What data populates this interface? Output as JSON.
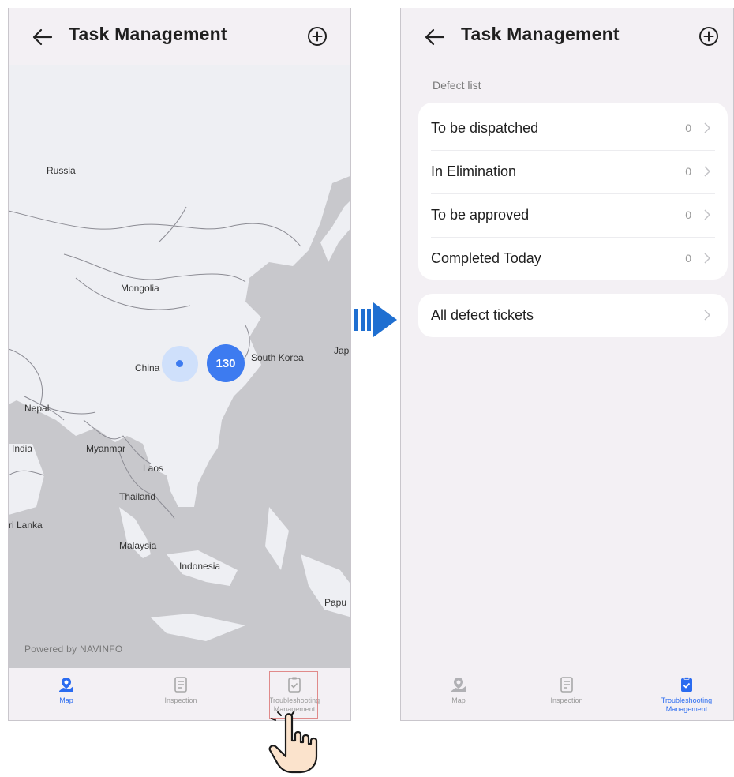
{
  "left_screen": {
    "header": {
      "title": "Task Management"
    },
    "map": {
      "labels": {
        "russia": "Russia",
        "mongolia": "Mongolia",
        "china": "China",
        "south_korea": "South Korea",
        "japan": "Jap",
        "nepal": "Nepal",
        "india": "India",
        "myanmar": "Myanmar",
        "laos": "Laos",
        "thailand": "Thailand",
        "sri_lanka": "ri Lanka",
        "malaysia": "Malaysia",
        "indonesia": "Indonesia",
        "papua": "Papu"
      },
      "cluster_count": "130",
      "attribution": "Powered by NAVINFO"
    },
    "bottom_nav": {
      "map": "Map",
      "inspection": "Inspection",
      "troubleshooting_line1": "Troubleshooting",
      "troubleshooting_line2": "Management"
    }
  },
  "right_screen": {
    "header": {
      "title": "Task Management"
    },
    "section_label": "Defect list",
    "defect_rows": [
      {
        "label": "To be dispatched",
        "count": "0"
      },
      {
        "label": "In Elimination",
        "count": "0"
      },
      {
        "label": "To be approved",
        "count": "0"
      },
      {
        "label": "Completed Today",
        "count": "0"
      }
    ],
    "all_tickets": {
      "label": "All defect tickets"
    },
    "bottom_nav": {
      "map": "Map",
      "inspection": "Inspection",
      "troubleshooting_line1": "Troubleshooting",
      "troubleshooting_line2": "Management"
    }
  },
  "colors": {
    "accent": "#2a6bf0",
    "cluster": "#3d7bf0",
    "arrow": "#1f6fd1",
    "highlight_box": "#e08a8a"
  }
}
